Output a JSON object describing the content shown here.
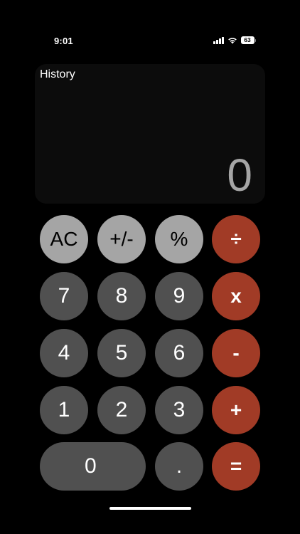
{
  "status_bar": {
    "time": "9:01",
    "battery": "63"
  },
  "display": {
    "history_label": "History",
    "value": "0"
  },
  "keypad": {
    "ac": "AC",
    "plus_minus": "+/-",
    "percent": "%",
    "divide": "÷",
    "seven": "7",
    "eight": "8",
    "nine": "9",
    "multiply": "x",
    "four": "4",
    "five": "5",
    "six": "6",
    "minus": "-",
    "one": "1",
    "two": "2",
    "three": "3",
    "plus": "+",
    "zero": "0",
    "decimal": ".",
    "equals": "="
  },
  "colors": {
    "background": "#000000",
    "display_panel": "#0c0c0c",
    "function_key": "#a5a5a5",
    "number_key": "#505050",
    "operator_key": "#a13b26",
    "display_text": "#a5a5a5"
  },
  "icons": {
    "signal": "cellular-signal-icon",
    "wifi": "wifi-icon",
    "battery": "battery-icon"
  }
}
